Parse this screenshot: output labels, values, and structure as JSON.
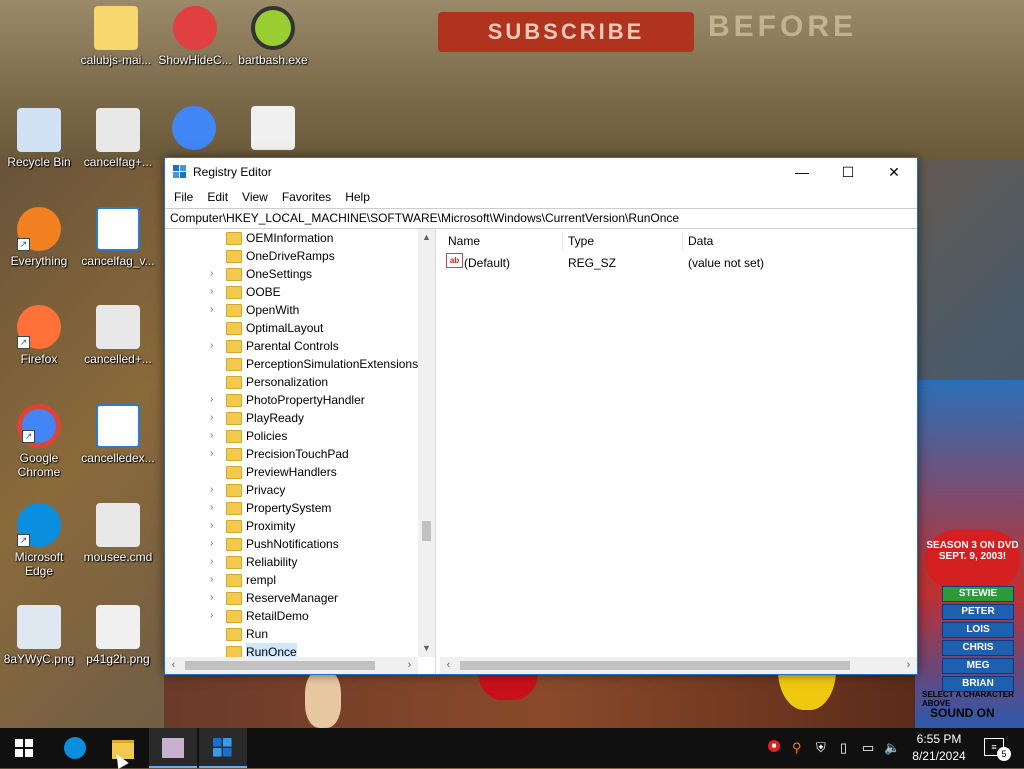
{
  "wallpaper": {
    "banner_text": "SUBSCRIBE",
    "banner_text_2": "BEFORE",
    "season_text": "SEASON 3 ON DVD SEPT. 9, 2003!",
    "characters": [
      "STEWIE",
      "PETER",
      "LOIS",
      "CHRIS",
      "MEG",
      "BRIAN"
    ],
    "select_text": "SELECT A CHARACTER ABOVE",
    "sound_text": "SOUND ON"
  },
  "desktop_icons": [
    {
      "label": "calubjs-mai...",
      "icon": "archive-icon",
      "color": "#f5d76e"
    },
    {
      "label": "ShowHideC...",
      "icon": "app-icon",
      "color": "#e04040"
    },
    {
      "label": "bartbash.exe",
      "icon": "gear-icon",
      "color": "#9acd32"
    },
    {
      "label": "Recycle Bin",
      "icon": "recycle-bin-icon",
      "color": "#cfe3f5"
    },
    {
      "label": "cancelfag+...",
      "icon": "settings-file-icon",
      "color": "#e8e8e8"
    },
    {
      "label": "Everything",
      "icon": "search-icon",
      "color": "#f08020"
    },
    {
      "label": "cancelfag_v...",
      "icon": "window-file-icon",
      "color": "#ffffff"
    },
    {
      "label": "Firefox",
      "icon": "firefox-icon",
      "color": "#ff7139"
    },
    {
      "label": "cancelled+...",
      "icon": "settings-file-icon",
      "color": "#e8e8e8"
    },
    {
      "label": "Google Chrome",
      "icon": "chrome-icon",
      "color": "#4285f4"
    },
    {
      "label": "cancelledex...",
      "icon": "window-file-icon",
      "color": "#ffffff"
    },
    {
      "label": "Microsoft Edge",
      "icon": "edge-icon",
      "color": "#0c8ede"
    },
    {
      "label": "mousee.cmd",
      "icon": "settings-file-icon",
      "color": "#e8e8e8"
    },
    {
      "label": "8aYWyC.png",
      "icon": "image-icon",
      "color": "#dfe8f0"
    },
    {
      "label": "p41g2h.png",
      "icon": "image-icon",
      "color": "#f0f0f0"
    }
  ],
  "registry": {
    "title": "Registry Editor",
    "window_controls": {
      "minimize": "—",
      "maximize": "☐",
      "close": "✕"
    },
    "menu": [
      "File",
      "Edit",
      "View",
      "Favorites",
      "Help"
    ],
    "address": "Computer\\HKEY_LOCAL_MACHINE\\SOFTWARE\\Microsoft\\Windows\\CurrentVersion\\RunOnce",
    "tree": [
      {
        "label": "OEMInformation",
        "expandable": false
      },
      {
        "label": "OneDriveRamps",
        "expandable": false
      },
      {
        "label": "OneSettings",
        "expandable": true
      },
      {
        "label": "OOBE",
        "expandable": true
      },
      {
        "label": "OpenWith",
        "expandable": true
      },
      {
        "label": "OptimalLayout",
        "expandable": false
      },
      {
        "label": "Parental Controls",
        "expandable": true
      },
      {
        "label": "PerceptionSimulationExtensions",
        "expandable": false
      },
      {
        "label": "Personalization",
        "expandable": false
      },
      {
        "label": "PhotoPropertyHandler",
        "expandable": true
      },
      {
        "label": "PlayReady",
        "expandable": true
      },
      {
        "label": "Policies",
        "expandable": true
      },
      {
        "label": "PrecisionTouchPad",
        "expandable": true
      },
      {
        "label": "PreviewHandlers",
        "expandable": false
      },
      {
        "label": "Privacy",
        "expandable": true
      },
      {
        "label": "PropertySystem",
        "expandable": true
      },
      {
        "label": "Proximity",
        "expandable": true
      },
      {
        "label": "PushNotifications",
        "expandable": true
      },
      {
        "label": "Reliability",
        "expandable": true
      },
      {
        "label": "rempl",
        "expandable": true
      },
      {
        "label": "ReserveManager",
        "expandable": true
      },
      {
        "label": "RetailDemo",
        "expandable": true
      },
      {
        "label": "Run",
        "expandable": false
      },
      {
        "label": "RunOnce",
        "expandable": false,
        "selected": true
      }
    ],
    "columns": [
      "Name",
      "Type",
      "Data"
    ],
    "values": [
      {
        "name": "(Default)",
        "type": "REG_SZ",
        "data": "(value not set)"
      }
    ]
  },
  "taskbar": {
    "time": "6:55 PM",
    "date": "8/21/2024",
    "notification_count": "5"
  }
}
